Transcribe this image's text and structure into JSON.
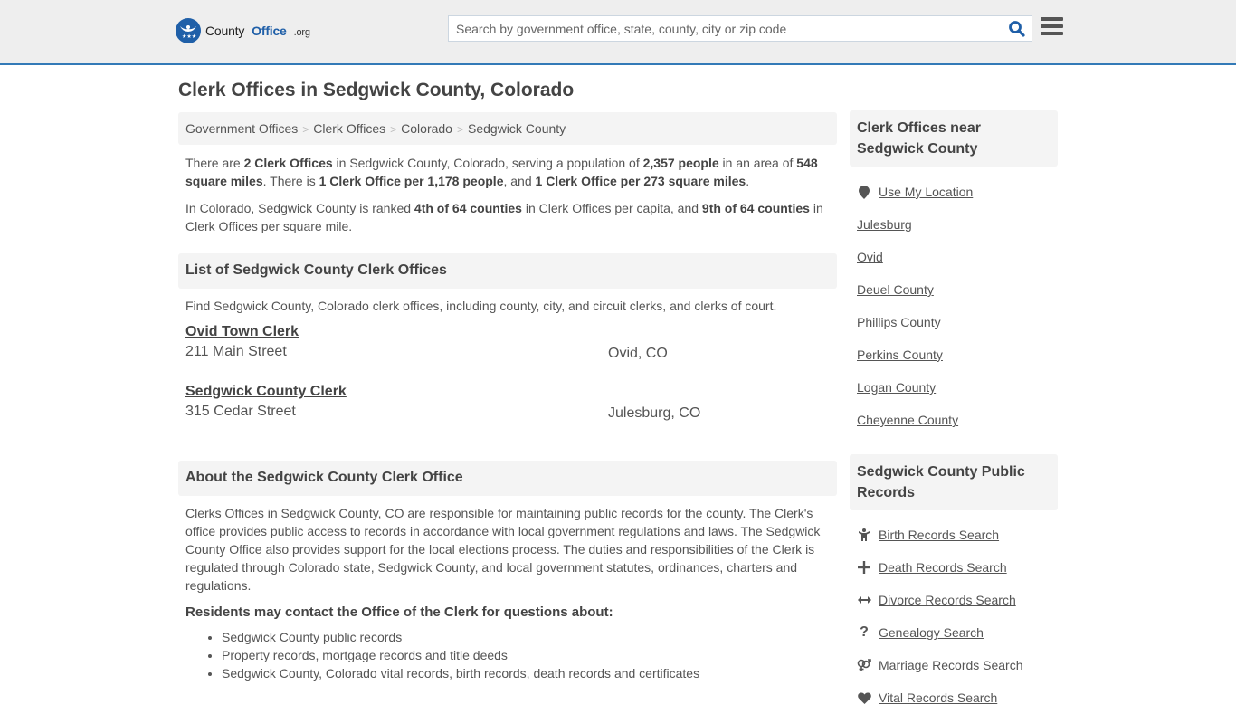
{
  "header": {
    "logo": {
      "county": "County",
      "office": "Office",
      "org": ".org"
    },
    "search": {
      "placeholder": "Search by government office, state, county, city or zip code",
      "value": ""
    },
    "icons": {
      "search": "search-icon",
      "menu": "hamburger-menu-icon"
    },
    "accent_color": "#337ab7"
  },
  "page_title": "Clerk Offices in Sedgwick County, Colorado",
  "breadcrumb": [
    "Government Offices",
    "Clerk Offices",
    "Colorado",
    "Sedgwick County"
  ],
  "intro": {
    "p1": {
      "t1": "There are ",
      "b1": "2 Clerk Offices",
      "t2": " in Sedgwick County, Colorado, serving a population of ",
      "b2": "2,357 people",
      "t3": " in an area of ",
      "b3": "548 square miles",
      "t4": ". There is ",
      "b4": "1 Clerk Office per 1,178 people",
      "t5": ", and ",
      "b5": "1 Clerk Office per 273 square miles",
      "t6": "."
    },
    "p2": {
      "t1": "In Colorado, Sedgwick County is ranked ",
      "b1": "4th of 64 counties",
      "t2": " in Clerk Offices per capita, and ",
      "b2": "9th of 64 counties",
      "t3": " in Clerk Offices per square mile."
    }
  },
  "list_section": {
    "heading": "List of Sedgwick County Clerk Offices",
    "description": "Find Sedgwick County, Colorado clerk offices, including county, city, and circuit clerks, and clerks of court.",
    "offices": [
      {
        "name": "Ovid Town Clerk",
        "address": "211 Main Street",
        "city": "Ovid, CO"
      },
      {
        "name": "Sedgwick County Clerk",
        "address": "315 Cedar Street",
        "city": "Julesburg, CO"
      }
    ]
  },
  "about_section": {
    "heading": "About the Sedgwick County Clerk Office",
    "text": "Clerks Offices in Sedgwick County, CO are responsible for maintaining public records for the county. The Clerk's office provides public access to records in accordance with local government regulations and laws. The Sedgwick County Office also provides support for the local elections process. The duties and responsibilities of the Clerk is regulated through Colorado state, Sedgwick County, and local government statutes, ordinances, charters and regulations.",
    "residents_heading": "Residents may contact the Office of the Clerk for questions about:",
    "bullets": [
      "Sedgwick County public records",
      "Property records, mortgage records and title deeds",
      "Sedgwick County, Colorado vital records, birth records, death records and certificates"
    ]
  },
  "sidebar": {
    "near": {
      "heading": "Clerk Offices near Sedgwick County",
      "use_location": {
        "label": "Use My Location",
        "icon": "map-marker-icon"
      },
      "links": [
        "Julesburg",
        "Ovid",
        "Deuel County",
        "Phillips County",
        "Perkins County",
        "Logan County",
        "Cheyenne County"
      ]
    },
    "records": {
      "heading": "Sedgwick County Public Records",
      "links": [
        {
          "label": "Birth Records Search",
          "icon": "child-icon"
        },
        {
          "label": "Death Records Search",
          "icon": "plus-icon"
        },
        {
          "label": "Divorce Records Search",
          "icon": "arrows-horizontal-icon"
        },
        {
          "label": "Genealogy Search",
          "icon": "question-icon"
        },
        {
          "label": "Marriage Records Search",
          "icon": "venus-mars-icon"
        },
        {
          "label": "Vital Records Search",
          "icon": "heartbeat-icon"
        }
      ]
    }
  }
}
